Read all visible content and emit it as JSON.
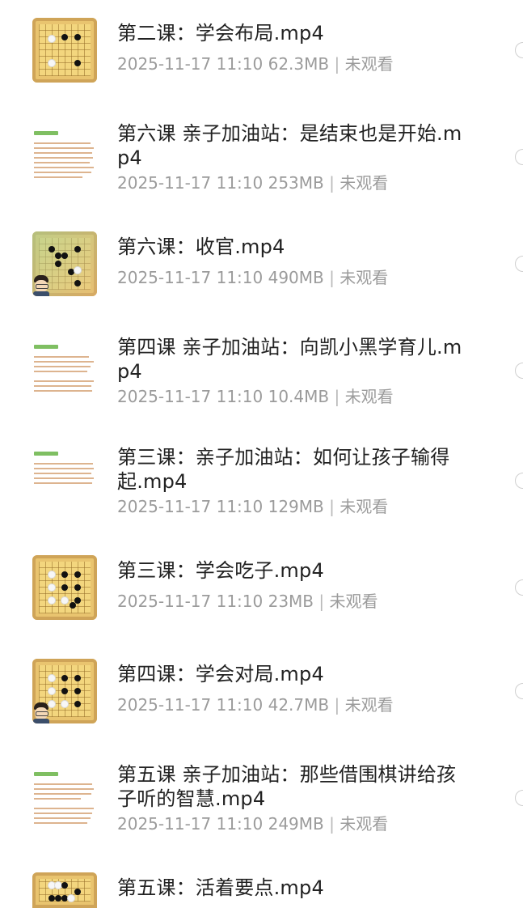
{
  "items": [
    {
      "title": "第二课：学会布局.mp4",
      "date": "2025-11-17 11:10",
      "size": "62.3MB",
      "status": "未观看",
      "thumb": "go-board"
    },
    {
      "title": "第六课 亲子加油站：是结束也是开始.mp4",
      "date": "2025-11-17 11:10",
      "size": "253MB",
      "status": "未观看",
      "thumb": "doc"
    },
    {
      "title": "第六课：收官.mp4",
      "date": "2025-11-17 11:10",
      "size": "490MB",
      "status": "未观看",
      "thumb": "go-board"
    },
    {
      "title": "第四课 亲子加油站：向凯小黑学育儿.mp4",
      "date": "2025-11-17 11:10",
      "size": "10.4MB",
      "status": "未观看",
      "thumb": "doc"
    },
    {
      "title": "第三课：亲子加油站：如何让孩子输得起.mp4",
      "date": "2025-11-17 11:10",
      "size": "129MB",
      "status": "未观看",
      "thumb": "doc"
    },
    {
      "title": "第三课：学会吃子.mp4",
      "date": "2025-11-17 11:10",
      "size": "23MB",
      "status": "未观看",
      "thumb": "go-board"
    },
    {
      "title": "第四课：学会对局.mp4",
      "date": "2025-11-17 11:10",
      "size": "42.7MB",
      "status": "未观看",
      "thumb": "go-board"
    },
    {
      "title": "第五课 亲子加油站：那些借围棋讲给孩子听的智慧.mp4",
      "date": "2025-11-17 11:10",
      "size": "249MB",
      "status": "未观看",
      "thumb": "doc"
    },
    {
      "title": "第五课：活着要点.mp4",
      "date": "",
      "size": "",
      "status": "",
      "thumb": "go-board"
    }
  ],
  "colors": {
    "title": "#222222",
    "meta": "#9b9b9b",
    "board": "#f3d67e",
    "board_frame": "#cfa458",
    "doc_accent": "#7fbf62",
    "doc_text": "#d7a77b"
  }
}
